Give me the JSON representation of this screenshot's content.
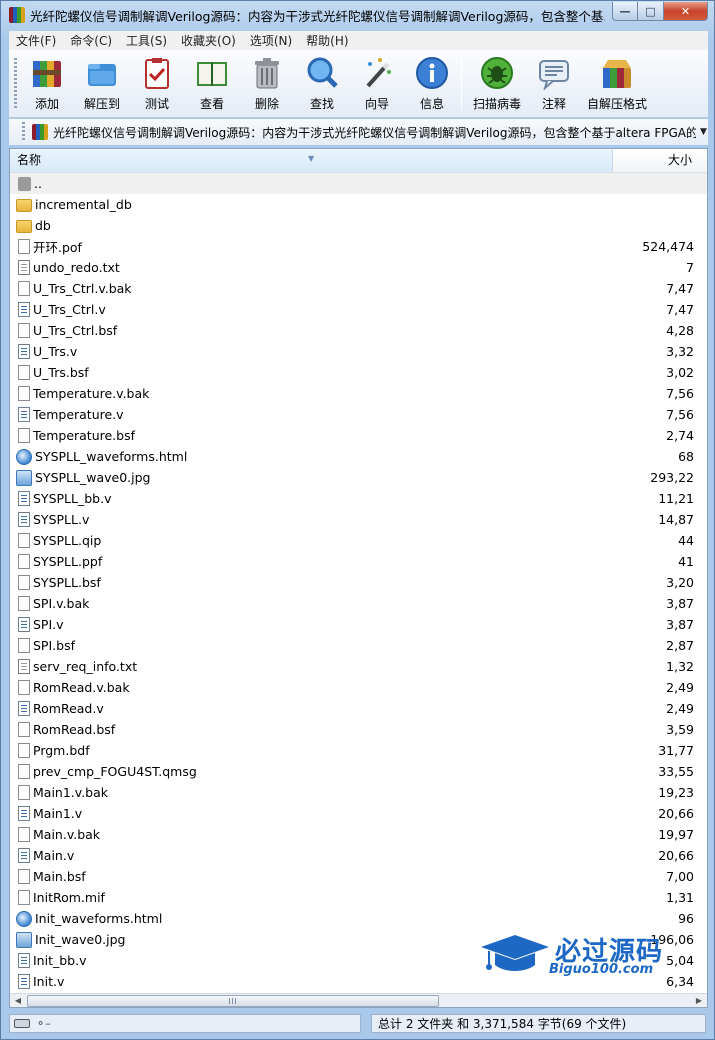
{
  "window": {
    "title": "光纤陀螺仪信号调制解调Verilog源码：内容为干涉式光纤陀螺仪信号调制解调Verilog源码，包含整个基..."
  },
  "menu": [
    "文件(F)",
    "命令(C)",
    "工具(S)",
    "收藏夹(O)",
    "选项(N)",
    "帮助(H)"
  ],
  "toolbar": [
    {
      "label": "添加",
      "icon": "add-archive-icon"
    },
    {
      "label": "解压到",
      "icon": "extract-to-icon"
    },
    {
      "label": "测试",
      "icon": "test-icon"
    },
    {
      "label": "查看",
      "icon": "view-icon"
    },
    {
      "label": "删除",
      "icon": "delete-icon"
    },
    {
      "label": "查找",
      "icon": "find-icon"
    },
    {
      "label": "向导",
      "icon": "wizard-icon"
    },
    {
      "label": "信息",
      "icon": "info-icon"
    },
    {
      "label": "扫描病毒",
      "icon": "virus-scan-icon"
    },
    {
      "label": "注释",
      "icon": "comment-icon"
    },
    {
      "label": "自解压格式",
      "icon": "sfx-icon"
    }
  ],
  "address": {
    "path": "光纤陀螺仪信号调制解调Verilog源码：内容为干涉式光纤陀螺仪信号调制解调Verilog源码，包含整个基于altera FPGA的"
  },
  "list": {
    "col_name": "名称",
    "col_size": "大小",
    "rows": [
      {
        "name": "..",
        "size": "",
        "type": "up"
      },
      {
        "name": "incremental_db",
        "size": "",
        "type": "folder"
      },
      {
        "name": "db",
        "size": "",
        "type": "folder"
      },
      {
        "name": "开环.pof",
        "size": "524,474",
        "type": "file"
      },
      {
        "name": "undo_redo.txt",
        "size": "7",
        "type": "txt"
      },
      {
        "name": "U_Trs_Ctrl.v.bak",
        "size": "7,47",
        "type": "file"
      },
      {
        "name": "U_Trs_Ctrl.v",
        "size": "7,47",
        "type": "vfile"
      },
      {
        "name": "U_Trs_Ctrl.bsf",
        "size": "4,28",
        "type": "file"
      },
      {
        "name": "U_Trs.v",
        "size": "3,32",
        "type": "vfile"
      },
      {
        "name": "U_Trs.bsf",
        "size": "3,02",
        "type": "file"
      },
      {
        "name": "Temperature.v.bak",
        "size": "7,56",
        "type": "file"
      },
      {
        "name": "Temperature.v",
        "size": "7,56",
        "type": "vfile"
      },
      {
        "name": "Temperature.bsf",
        "size": "2,74",
        "type": "file"
      },
      {
        "name": "SYSPLL_waveforms.html",
        "size": "68",
        "type": "html"
      },
      {
        "name": "SYSPLL_wave0.jpg",
        "size": "293,22",
        "type": "jpg"
      },
      {
        "name": "SYSPLL_bb.v",
        "size": "11,21",
        "type": "vfile"
      },
      {
        "name": "SYSPLL.v",
        "size": "14,87",
        "type": "vfile"
      },
      {
        "name": "SYSPLL.qip",
        "size": "44",
        "type": "file"
      },
      {
        "name": "SYSPLL.ppf",
        "size": "41",
        "type": "file"
      },
      {
        "name": "SYSPLL.bsf",
        "size": "3,20",
        "type": "file"
      },
      {
        "name": "SPI.v.bak",
        "size": "3,87",
        "type": "file"
      },
      {
        "name": "SPI.v",
        "size": "3,87",
        "type": "vfile"
      },
      {
        "name": "SPI.bsf",
        "size": "2,87",
        "type": "file"
      },
      {
        "name": "serv_req_info.txt",
        "size": "1,32",
        "type": "txt"
      },
      {
        "name": "RomRead.v.bak",
        "size": "2,49",
        "type": "file"
      },
      {
        "name": "RomRead.v",
        "size": "2,49",
        "type": "vfile"
      },
      {
        "name": "RomRead.bsf",
        "size": "3,59",
        "type": "file"
      },
      {
        "name": "Prgm.bdf",
        "size": "31,77",
        "type": "file"
      },
      {
        "name": "prev_cmp_FOGU4ST.qmsg",
        "size": "33,55",
        "type": "file"
      },
      {
        "name": "Main1.v.bak",
        "size": "19,23",
        "type": "file"
      },
      {
        "name": "Main1.v",
        "size": "20,66",
        "type": "vfile"
      },
      {
        "name": "Main.v.bak",
        "size": "19,97",
        "type": "file"
      },
      {
        "name": "Main.v",
        "size": "20,66",
        "type": "vfile"
      },
      {
        "name": "Main.bsf",
        "size": "7,00",
        "type": "file"
      },
      {
        "name": "InitRom.mif",
        "size": "1,31",
        "type": "file"
      },
      {
        "name": "Init_waveforms.html",
        "size": "96",
        "type": "html"
      },
      {
        "name": "Init_wave0.jpg",
        "size": "196,06",
        "type": "jpg"
      },
      {
        "name": "Init_bb.v",
        "size": "5,04",
        "type": "vfile"
      },
      {
        "name": "Init.v",
        "size": "6,34",
        "type": "vfile"
      }
    ]
  },
  "status": {
    "summary": "总计 2 文件夹 和 3,371,584 字节(69 个文件)"
  },
  "watermark": {
    "title": "必过源码",
    "url": "Biguo100.com"
  }
}
